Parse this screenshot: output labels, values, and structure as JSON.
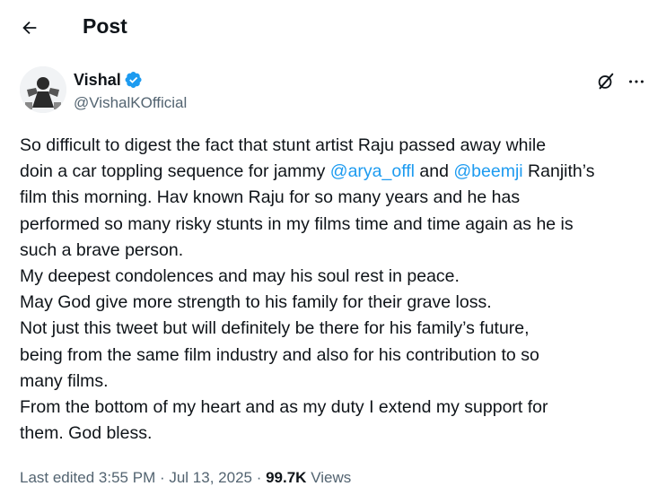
{
  "header": {
    "title": "Post",
    "back_icon": "arrow-left-icon"
  },
  "author": {
    "name": "Vishal",
    "handle": "@VishalKOfficial",
    "verified_icon": "verified-badge-icon",
    "verified_color": "#1d9bf0"
  },
  "actions": {
    "grok_icon": "grok-icon",
    "more_icon": "more-icon"
  },
  "tweet": {
    "line1": "So difficult to digest the fact that stunt artist Raju passed away while",
    "line2_before": "doin a car toppling sequence for jammy ",
    "mention1": "@arya_offl",
    "line2_mid": " and ",
    "mention2": "@beemji",
    "line2_after": " Ranjith’s",
    "line3": "film this morning. Hav known Raju for so many years and he has",
    "line4": "performed so many risky stunts in my films time and time again as he is",
    "line5": "such a brave person.",
    "line6": "My deepest condolences and may his soul rest in peace.",
    "line7": "May God give more strength to his family for their grave loss.",
    "line8": "Not just this tweet but will definitely be there for his family’s future,",
    "line9": "being from the same film industry and also for his contribution to so",
    "line10": "many films.",
    "line11": "From the bottom of my heart and as my duty I extend my support for",
    "line12": "them.  God bless."
  },
  "meta": {
    "edited_label": "Last edited",
    "time": "3:55 PM",
    "separator": " · ",
    "date": "Jul 13, 2025",
    "views_count": "99.7K",
    "views_label": "Views"
  },
  "colors": {
    "link": "#1d9bf0",
    "secondary_text": "#536471",
    "primary_text": "#0f1419"
  }
}
